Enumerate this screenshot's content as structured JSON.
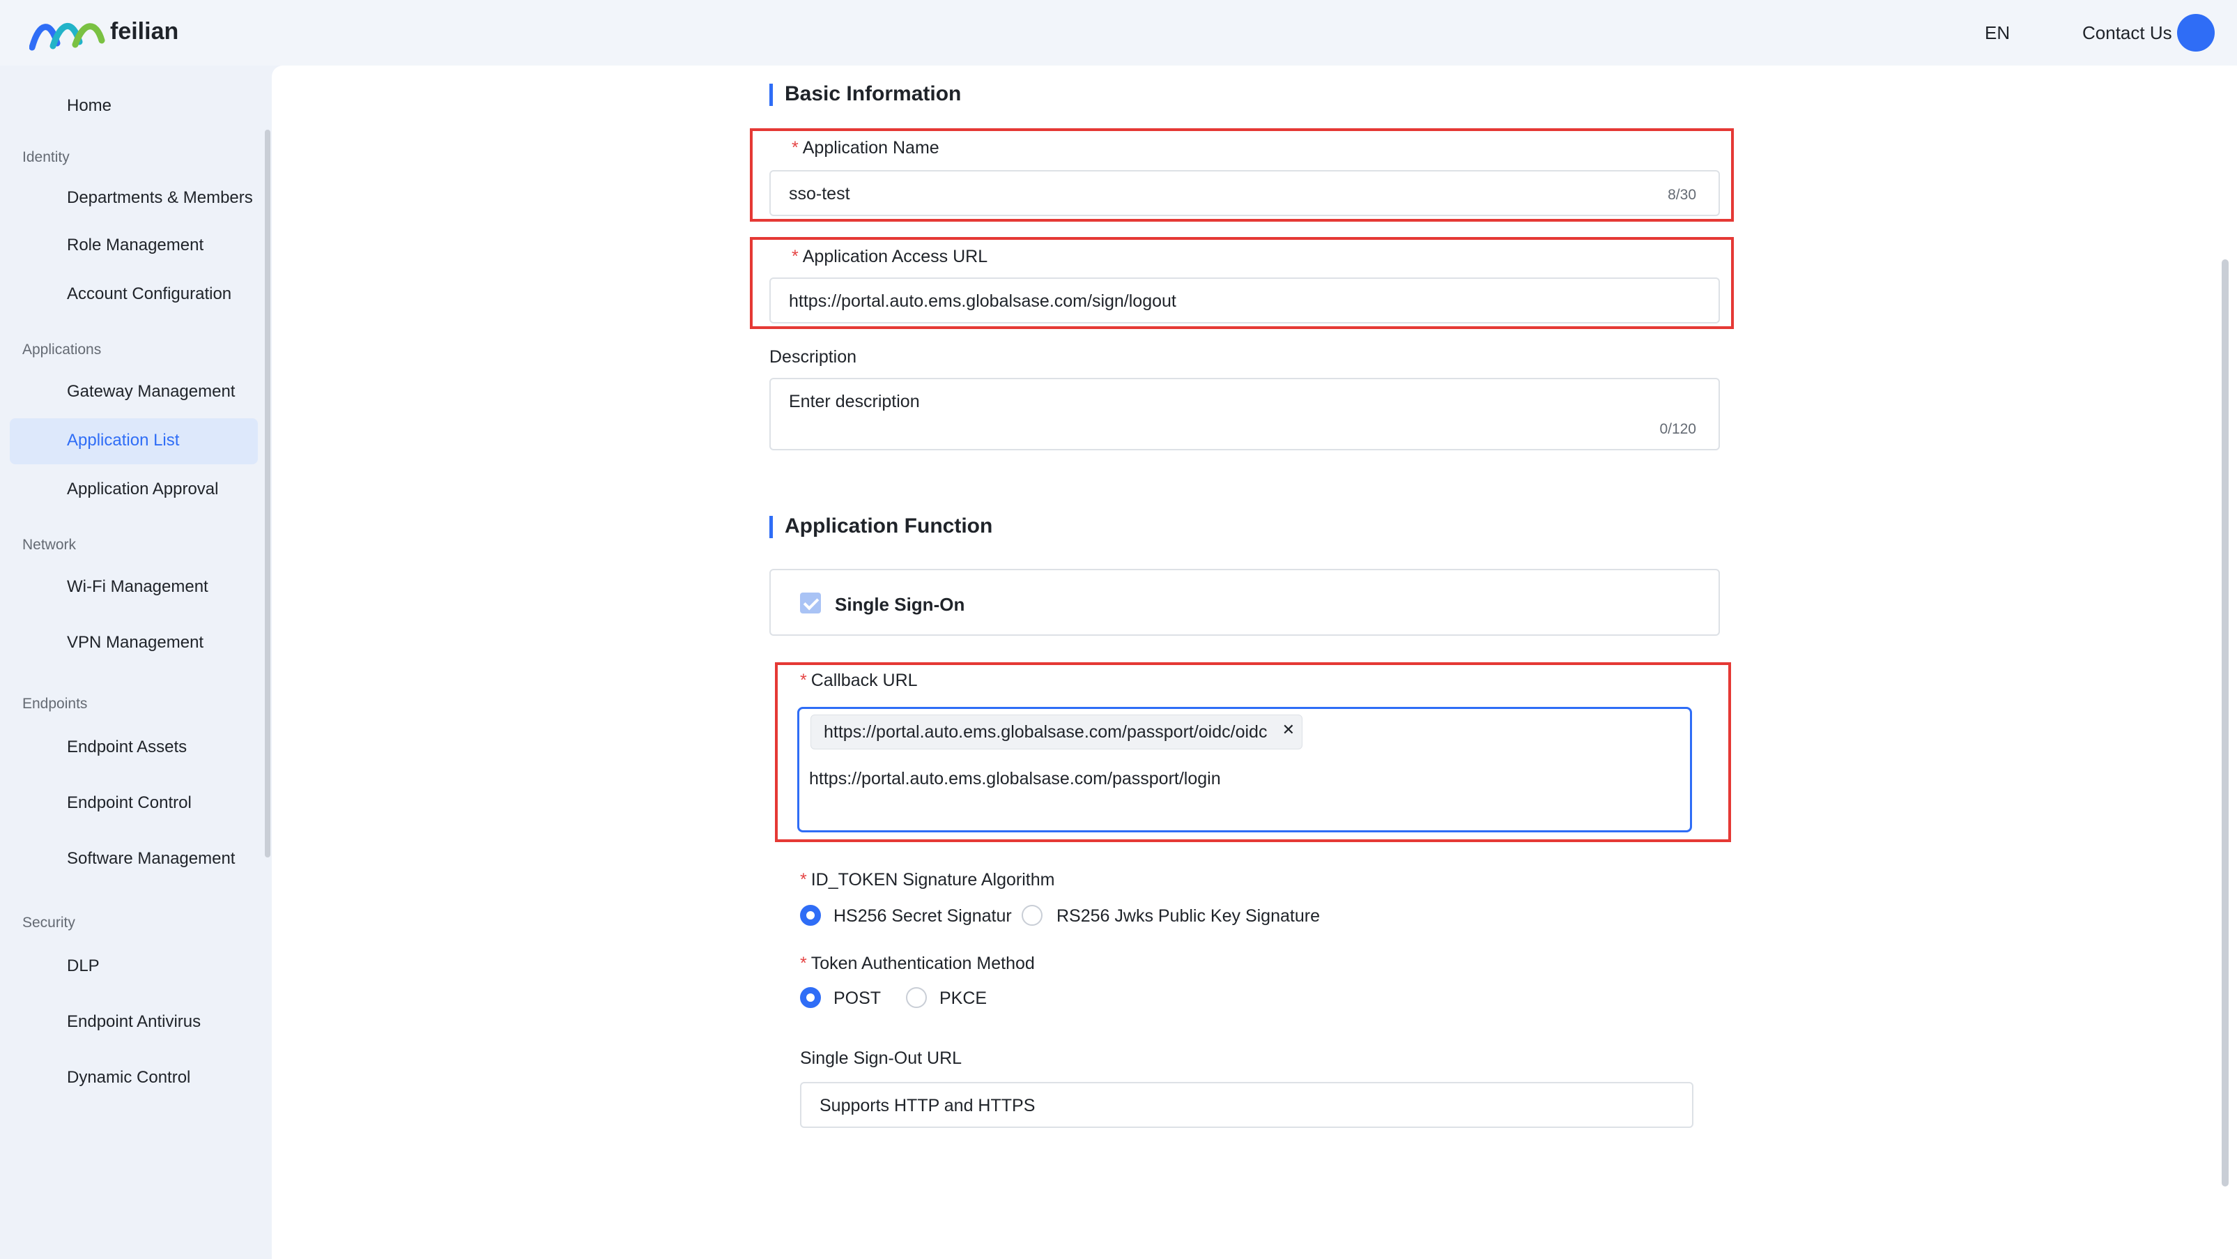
{
  "header": {
    "brand": "feilian",
    "lang": "EN",
    "contact": "Contact Us"
  },
  "sidebar": {
    "home": "Home",
    "groups": {
      "identity": "Identity",
      "applications": "Applications",
      "network": "Network",
      "endpoints": "Endpoints",
      "security": "Security"
    },
    "items": {
      "departments": "Departments & Members",
      "role": "Role Management",
      "account": "Account Configuration",
      "gateway": "Gateway Management",
      "app_list": "Application List",
      "app_approval": "Application Approval",
      "wifi": "Wi-Fi Management",
      "vpn": "VPN Management",
      "endpoint_assets": "Endpoint Assets",
      "endpoint_control": "Endpoint Control",
      "software": "Software Management",
      "dlp": "DLP",
      "antivirus": "Endpoint Antivirus",
      "dynamic": "Dynamic Control"
    }
  },
  "basic": {
    "title": "Basic Information",
    "app_name_label": "Application Name",
    "app_name_value": "sso-test",
    "app_name_counter": "8/30",
    "access_url_label": "Application Access URL",
    "access_url_value": "https://portal.auto.ems.globalsase.com/sign/logout",
    "description_label": "Description",
    "description_placeholder": "Enter description",
    "description_counter": "0/120"
  },
  "function": {
    "title": "Application Function",
    "sso_label": "Single Sign-On",
    "callback_label": "Callback URL",
    "callback_tag": "https://portal.auto.ems.globalsase.com/passport/oidc/oidc",
    "callback_input": "https://portal.auto.ems.globalsase.com/passport/login",
    "id_token_label": "ID_TOKEN Signature Algorithm",
    "id_token_opt1": "HS256 Secret Signatur",
    "id_token_opt2": "RS256 Jwks Public Key Signature",
    "token_auth_label": "Token Authentication Method",
    "token_opt1": "POST",
    "token_opt2": "PKCE",
    "signout_label": "Single Sign-Out URL",
    "signout_placeholder": "Supports HTTP and HTTPS"
  },
  "colors": {
    "accent": "#2f6df6",
    "highlight": "#e53935",
    "required": "#e54545"
  }
}
